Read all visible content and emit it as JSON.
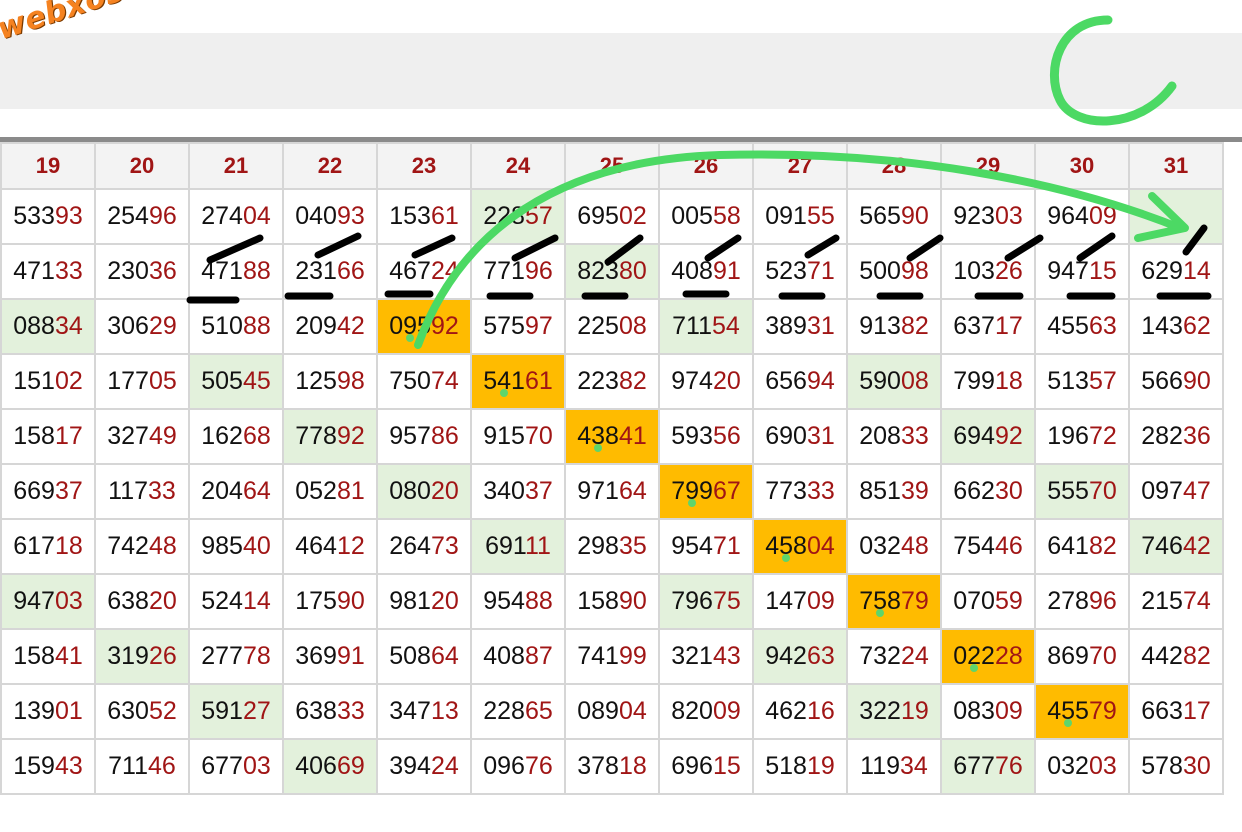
{
  "site": {
    "logo_text": "webxoso.net"
  },
  "table": {
    "headers": [
      "19",
      "20",
      "21",
      "22",
      "23",
      "24",
      "25",
      "26",
      "27",
      "28",
      "29",
      "30",
      "31"
    ],
    "rows": [
      [
        {
          "h": "533",
          "t": "93"
        },
        {
          "h": "254",
          "t": "96"
        },
        {
          "h": "274",
          "t": "04"
        },
        {
          "h": "040",
          "t": "93"
        },
        {
          "h": "153",
          "t": "61"
        },
        {
          "h": "228",
          "t": "57",
          "hl": "green"
        },
        {
          "h": "695",
          "t": "02"
        },
        {
          "h": "005",
          "t": "58"
        },
        {
          "h": "091",
          "t": "55"
        },
        {
          "h": "565",
          "t": "90"
        },
        {
          "h": "923",
          "t": "03"
        },
        {
          "h": "964",
          "t": "09"
        },
        {
          "h": "",
          "t": "",
          "hl": "green"
        }
      ],
      [
        {
          "h": "471",
          "t": "33"
        },
        {
          "h": "230",
          "t": "36"
        },
        {
          "h": "471",
          "t": "88"
        },
        {
          "h": "231",
          "t": "66"
        },
        {
          "h": "467",
          "t": "24"
        },
        {
          "h": "771",
          "t": "96"
        },
        {
          "h": "823",
          "t": "80",
          "hl": "green"
        },
        {
          "h": "408",
          "t": "91"
        },
        {
          "h": "523",
          "t": "71"
        },
        {
          "h": "500",
          "t": "98"
        },
        {
          "h": "103",
          "t": "26"
        },
        {
          "h": "947",
          "t": "15"
        },
        {
          "h": "629",
          "t": "14"
        }
      ],
      [
        {
          "h": "088",
          "t": "34",
          "hl": "green"
        },
        {
          "h": "306",
          "t": "29"
        },
        {
          "h": "510",
          "t": "88"
        },
        {
          "h": "209",
          "t": "42"
        },
        {
          "h": "095",
          "t": "92",
          "hl": "orange"
        },
        {
          "h": "575",
          "t": "97"
        },
        {
          "h": "225",
          "t": "08"
        },
        {
          "h": "711",
          "t": "54",
          "hl": "green"
        },
        {
          "h": "389",
          "t": "31"
        },
        {
          "h": "913",
          "t": "82"
        },
        {
          "h": "637",
          "t": "17"
        },
        {
          "h": "455",
          "t": "63"
        },
        {
          "h": "143",
          "t": "62"
        }
      ],
      [
        {
          "h": "151",
          "t": "02"
        },
        {
          "h": "177",
          "t": "05"
        },
        {
          "h": "505",
          "t": "45",
          "hl": "green"
        },
        {
          "h": "125",
          "t": "98"
        },
        {
          "h": "750",
          "t": "74"
        },
        {
          "h": "541",
          "t": "61",
          "hl": "orange"
        },
        {
          "h": "223",
          "t": "82"
        },
        {
          "h": "974",
          "t": "20"
        },
        {
          "h": "656",
          "t": "94"
        },
        {
          "h": "590",
          "t": "08",
          "hl": "green"
        },
        {
          "h": "799",
          "t": "18"
        },
        {
          "h": "513",
          "t": "57"
        },
        {
          "h": "566",
          "t": "90"
        }
      ],
      [
        {
          "h": "158",
          "t": "17"
        },
        {
          "h": "327",
          "t": "49"
        },
        {
          "h": "162",
          "t": "68"
        },
        {
          "h": "778",
          "t": "92",
          "hl": "green"
        },
        {
          "h": "957",
          "t": "86"
        },
        {
          "h": "915",
          "t": "70"
        },
        {
          "h": "438",
          "t": "41",
          "hl": "orange"
        },
        {
          "h": "593",
          "t": "56"
        },
        {
          "h": "690",
          "t": "31"
        },
        {
          "h": "208",
          "t": "33"
        },
        {
          "h": "694",
          "t": "92",
          "hl": "green"
        },
        {
          "h": "196",
          "t": "72"
        },
        {
          "h": "282",
          "t": "36"
        }
      ],
      [
        {
          "h": "669",
          "t": "37"
        },
        {
          "h": "117",
          "t": "33"
        },
        {
          "h": "204",
          "t": "64"
        },
        {
          "h": "052",
          "t": "81"
        },
        {
          "h": "080",
          "t": "20",
          "hl": "green"
        },
        {
          "h": "340",
          "t": "37"
        },
        {
          "h": "971",
          "t": "64"
        },
        {
          "h": "799",
          "t": "67",
          "hl": "orange"
        },
        {
          "h": "773",
          "t": "33"
        },
        {
          "h": "851",
          "t": "39"
        },
        {
          "h": "662",
          "t": "30"
        },
        {
          "h": "555",
          "t": "70",
          "hl": "green"
        },
        {
          "h": "097",
          "t": "47"
        }
      ],
      [
        {
          "h": "617",
          "t": "18"
        },
        {
          "h": "742",
          "t": "48"
        },
        {
          "h": "985",
          "t": "40"
        },
        {
          "h": "464",
          "t": "12"
        },
        {
          "h": "264",
          "t": "73"
        },
        {
          "h": "691",
          "t": "11",
          "hl": "green"
        },
        {
          "h": "298",
          "t": "35"
        },
        {
          "h": "954",
          "t": "71"
        },
        {
          "h": "458",
          "t": "04",
          "hl": "orange"
        },
        {
          "h": "032",
          "t": "48"
        },
        {
          "h": "754",
          "t": "46"
        },
        {
          "h": "641",
          "t": "82"
        },
        {
          "h": "746",
          "t": "42",
          "hl": "green"
        }
      ],
      [
        {
          "h": "947",
          "t": "03",
          "hl": "green"
        },
        {
          "h": "638",
          "t": "20"
        },
        {
          "h": "524",
          "t": "14"
        },
        {
          "h": "175",
          "t": "90"
        },
        {
          "h": "981",
          "t": "20"
        },
        {
          "h": "954",
          "t": "88"
        },
        {
          "h": "158",
          "t": "90"
        },
        {
          "h": "796",
          "t": "75",
          "hl": "green"
        },
        {
          "h": "147",
          "t": "09"
        },
        {
          "h": "758",
          "t": "79",
          "hl": "orange"
        },
        {
          "h": "070",
          "t": "59"
        },
        {
          "h": "278",
          "t": "96"
        },
        {
          "h": "215",
          "t": "74"
        }
      ],
      [
        {
          "h": "158",
          "t": "41"
        },
        {
          "h": "319",
          "t": "26",
          "hl": "green"
        },
        {
          "h": "277",
          "t": "78"
        },
        {
          "h": "369",
          "t": "91"
        },
        {
          "h": "508",
          "t": "64"
        },
        {
          "h": "408",
          "t": "87"
        },
        {
          "h": "741",
          "t": "99"
        },
        {
          "h": "321",
          "t": "43"
        },
        {
          "h": "942",
          "t": "63",
          "hl": "green"
        },
        {
          "h": "732",
          "t": "24"
        },
        {
          "h": "022",
          "t": "28",
          "hl": "orange"
        },
        {
          "h": "869",
          "t": "70"
        },
        {
          "h": "442",
          "t": "82"
        }
      ],
      [
        {
          "h": "139",
          "t": "01"
        },
        {
          "h": "630",
          "t": "52"
        },
        {
          "h": "591",
          "t": "27",
          "hl": "green"
        },
        {
          "h": "638",
          "t": "33"
        },
        {
          "h": "347",
          "t": "13"
        },
        {
          "h": "228",
          "t": "65"
        },
        {
          "h": "089",
          "t": "04"
        },
        {
          "h": "820",
          "t": "09"
        },
        {
          "h": "462",
          "t": "16"
        },
        {
          "h": "322",
          "t": "19",
          "hl": "green"
        },
        {
          "h": "083",
          "t": "09"
        },
        {
          "h": "455",
          "t": "79",
          "hl": "orange"
        },
        {
          "h": "663",
          "t": "17"
        }
      ],
      [
        {
          "h": "159",
          "t": "43"
        },
        {
          "h": "711",
          "t": "46"
        },
        {
          "h": "677",
          "t": "03"
        },
        {
          "h": "406",
          "t": "69",
          "hl": "green"
        },
        {
          "h": "394",
          "t": "24"
        },
        {
          "h": "096",
          "t": "76"
        },
        {
          "h": "378",
          "t": "18"
        },
        {
          "h": "696",
          "t": "15"
        },
        {
          "h": "518",
          "t": "19"
        },
        {
          "h": "119",
          "t": "34"
        },
        {
          "h": "677",
          "t": "76",
          "hl": "green"
        },
        {
          "h": "032",
          "t": "03"
        },
        {
          "h": "578",
          "t": "30"
        }
      ]
    ]
  }
}
